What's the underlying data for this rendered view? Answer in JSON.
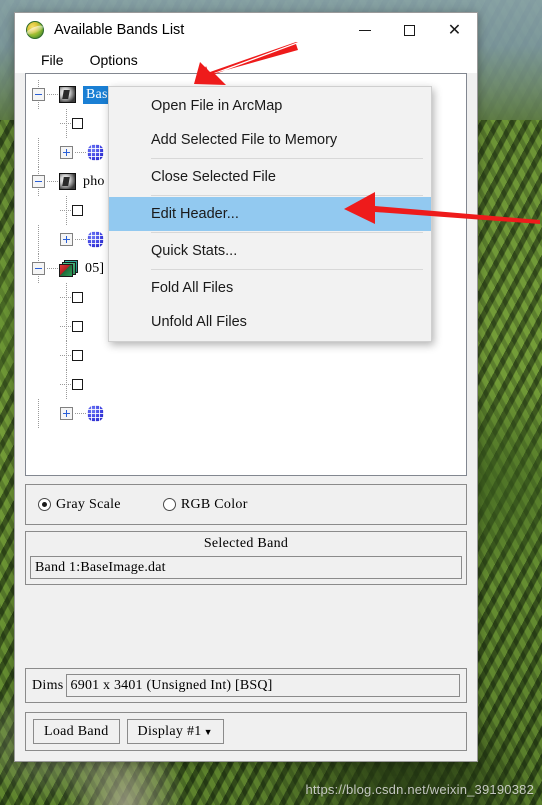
{
  "window": {
    "title": "Available Bands List",
    "app_icon": "envi-globe-icon",
    "controls": {
      "minimize": "minimize-icon",
      "maximize": "maximize-icon",
      "close": "close-icon"
    }
  },
  "menubar": {
    "items": [
      {
        "label": "File"
      },
      {
        "label": "Options"
      }
    ]
  },
  "tree": {
    "nodes": [
      {
        "label": "BaseImage.dat",
        "icon": "raster-file-icon",
        "selected": true,
        "expander": "minus",
        "children": [
          {
            "icon": "band-checkbox-icon",
            "expander": "none",
            "label": ""
          },
          {
            "icon": "map-info-globe-icon",
            "expander": "plus",
            "label": ""
          }
        ]
      },
      {
        "label": "pho",
        "icon": "raster-file-icon",
        "selected": false,
        "expander": "minus",
        "children": [
          {
            "icon": "band-checkbox-icon",
            "expander": "none",
            "label": ""
          },
          {
            "icon": "map-info-globe-icon",
            "expander": "plus",
            "label": ""
          }
        ]
      },
      {
        "label": "05]",
        "icon": "layer-stack-icon",
        "selected": false,
        "expander": "minus",
        "children": [
          {
            "icon": "band-checkbox-icon",
            "expander": "none",
            "label": ""
          },
          {
            "icon": "band-checkbox-icon",
            "expander": "none",
            "label": ""
          },
          {
            "icon": "band-checkbox-icon",
            "expander": "none",
            "label": ""
          },
          {
            "icon": "band-checkbox-icon",
            "expander": "none",
            "label": ""
          },
          {
            "icon": "map-info-globe-icon",
            "expander": "plus",
            "label": ""
          }
        ]
      }
    ]
  },
  "context_menu": {
    "items": [
      {
        "label": "Open File in ArcMap",
        "highlighted": false,
        "separator_after": false
      },
      {
        "label": "Add Selected File to Memory",
        "highlighted": false,
        "separator_after": true
      },
      {
        "label": "Close Selected File",
        "highlighted": false,
        "separator_after": true
      },
      {
        "label": "Edit Header...",
        "highlighted": true,
        "separator_after": true
      },
      {
        "label": "Quick Stats...",
        "highlighted": false,
        "separator_after": true
      },
      {
        "label": "Fold All Files",
        "highlighted": false,
        "separator_after": false
      },
      {
        "label": "Unfold All Files",
        "highlighted": false,
        "separator_after": false
      }
    ]
  },
  "display_mode": {
    "options": [
      {
        "label": "Gray Scale",
        "selected": true
      },
      {
        "label": "RGB Color",
        "selected": false
      }
    ]
  },
  "selected_band": {
    "title": "Selected Band",
    "value": "Band 1:BaseImage.dat"
  },
  "dims": {
    "label": "Dims",
    "value": "6901 x 3401 (Unsigned Int) [BSQ]"
  },
  "actions": {
    "load_band": "Load Band",
    "display": "Display #1",
    "display_caret": "▼"
  },
  "annotations": {
    "arrow_color": "#ee1b1b",
    "arrow1_target": "tree-selected-file",
    "arrow2_target": "edit-header-menu-item"
  },
  "watermark": "https://blog.csdn.net/weixin_39190382"
}
